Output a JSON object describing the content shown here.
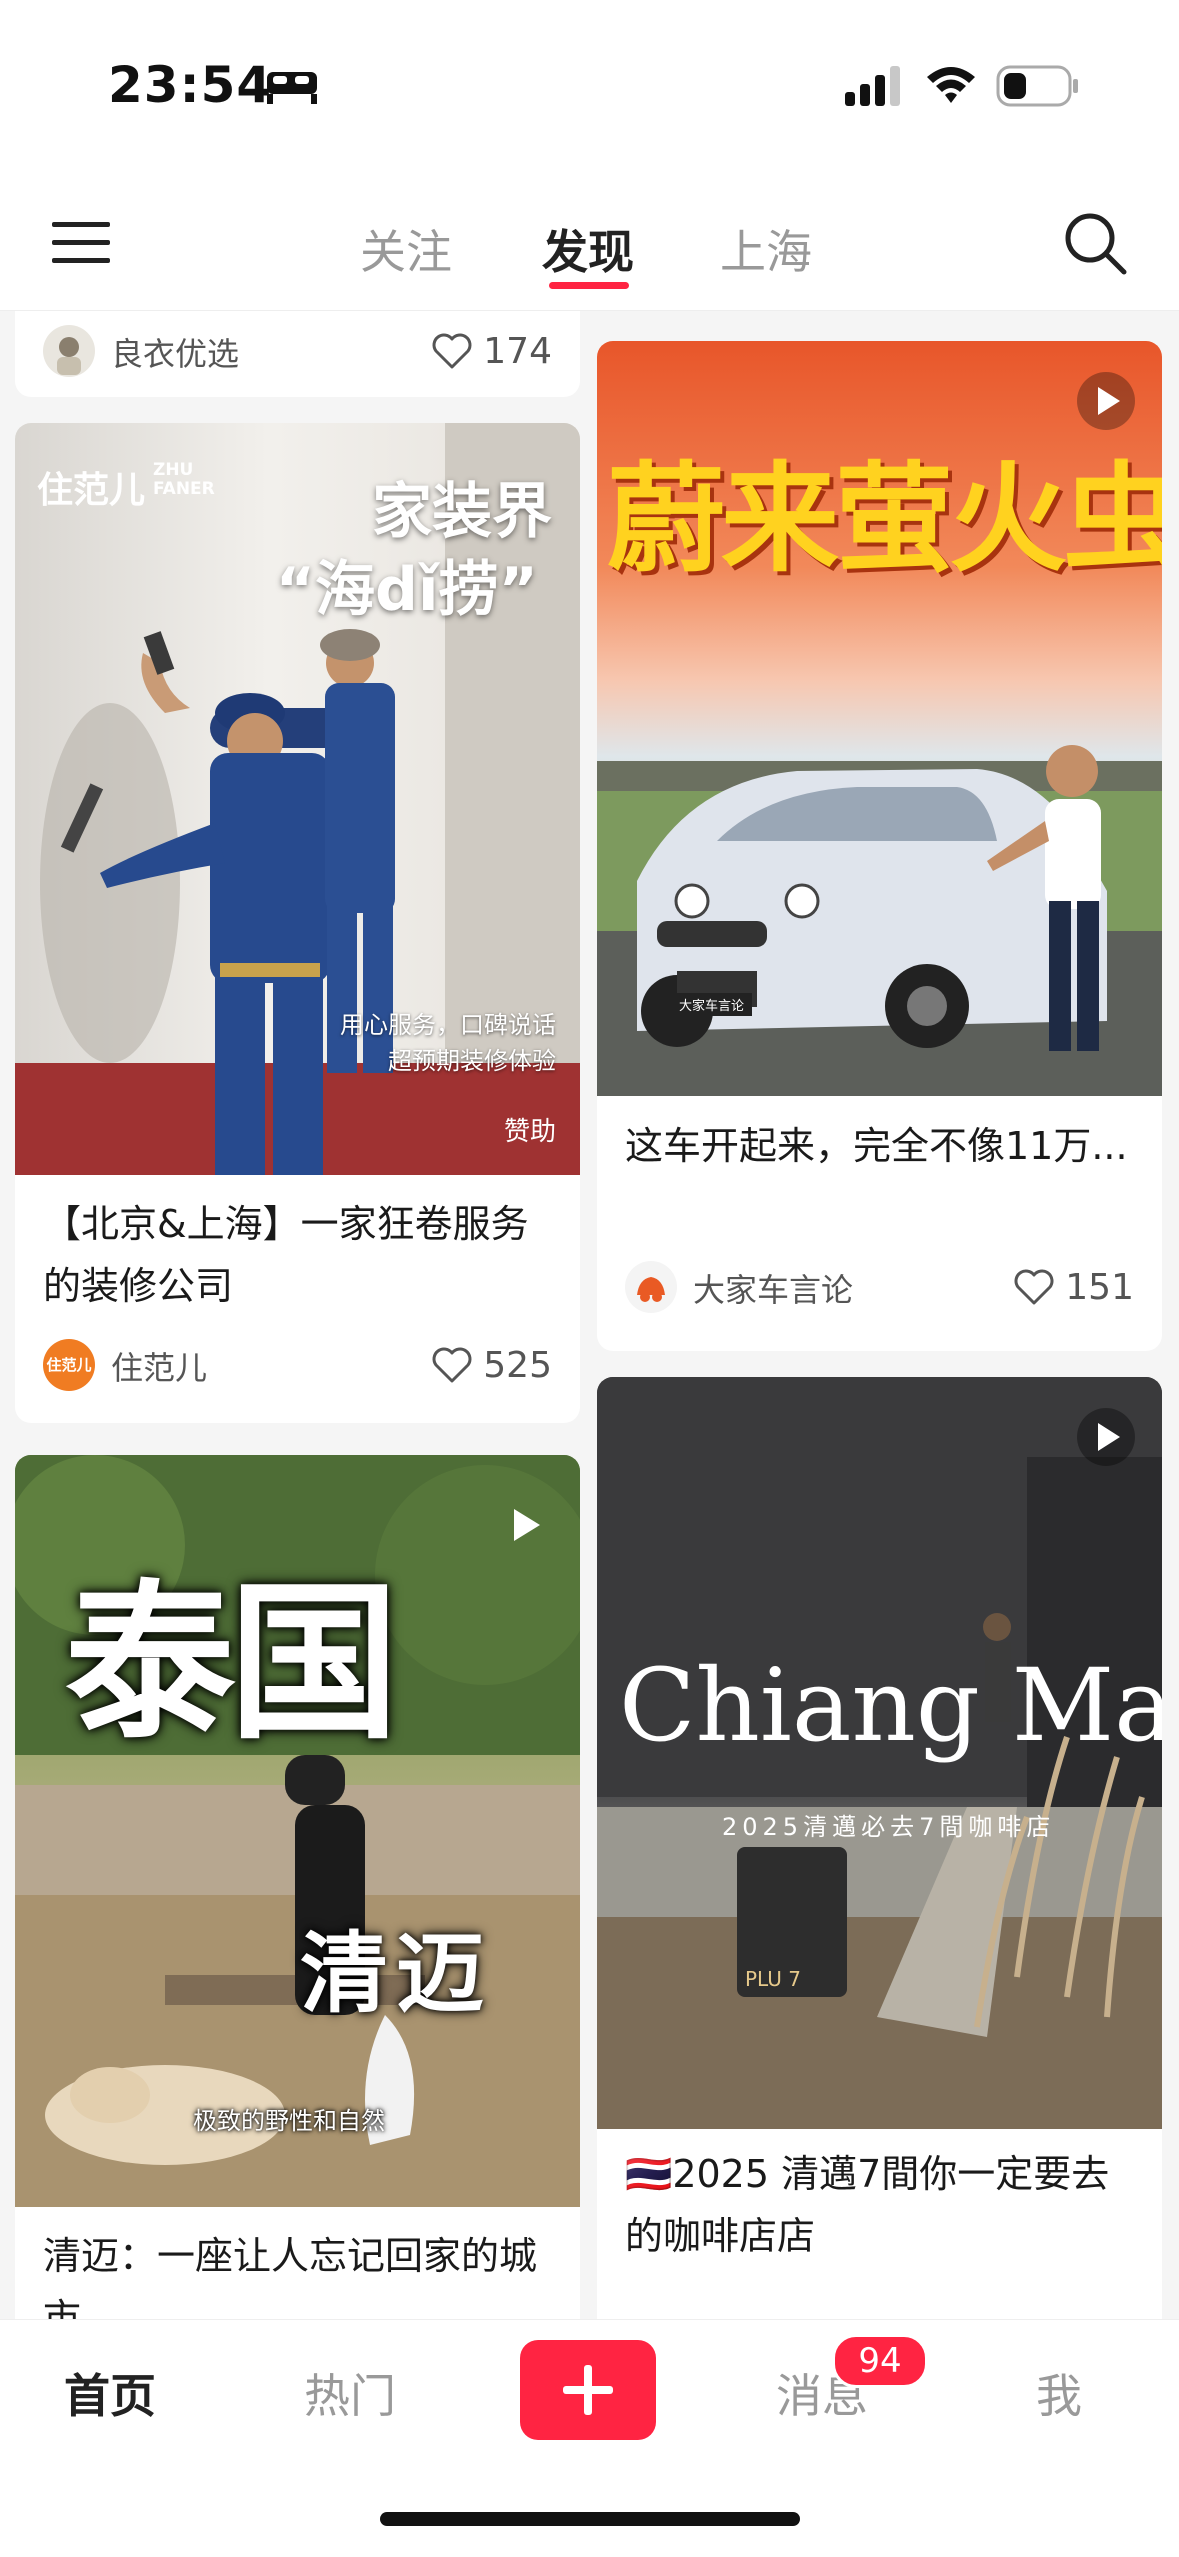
{
  "status_bar": {
    "time": "23:54"
  },
  "topnav": {
    "tabs": [
      "关注",
      "发现",
      "上海"
    ],
    "active_tab": "发现"
  },
  "feed": {
    "left": [
      {
        "author": "良衣优选",
        "likes": "174"
      },
      {
        "title": "【北京&上海】一家狂卷服务的装修公司",
        "author": "住范儿",
        "likes": "525",
        "avatar_text": "住范儿",
        "cover": {
          "brand": "住范儿",
          "brand_en_1": "ZHU",
          "brand_en_2": "FANER",
          "headline_1": "家装界",
          "headline_2": "“海dǐ捞”",
          "slogan_1": "用心服务，口碑说话",
          "slogan_2": "超预期装修体验",
          "tag": "赞助"
        }
      },
      {
        "title": "清迈：一座让人忘记回家的城市",
        "cover": {
          "headline_1": "泰国",
          "headline_2": "清迈",
          "caption": "极致的野性和自然"
        }
      }
    ],
    "right": [
      {
        "title": "这车开起来，完全不像11万...",
        "author": "大家车言论",
        "likes": "151",
        "cover": {
          "headline": "蔚来萤火虫",
          "plate": "大家车言论"
        }
      },
      {
        "title": "🇹🇭2025 清邁7間你一定要去的咖啡店店",
        "cover": {
          "headline": "Chiang Mai",
          "subtitle": "2025清邁必去7間咖啡店",
          "sign": "PLU 7"
        }
      }
    ]
  },
  "tabbar": {
    "items": [
      "首页",
      "热门",
      "消息",
      "我"
    ],
    "active": "首页",
    "messages_badge": "94"
  }
}
